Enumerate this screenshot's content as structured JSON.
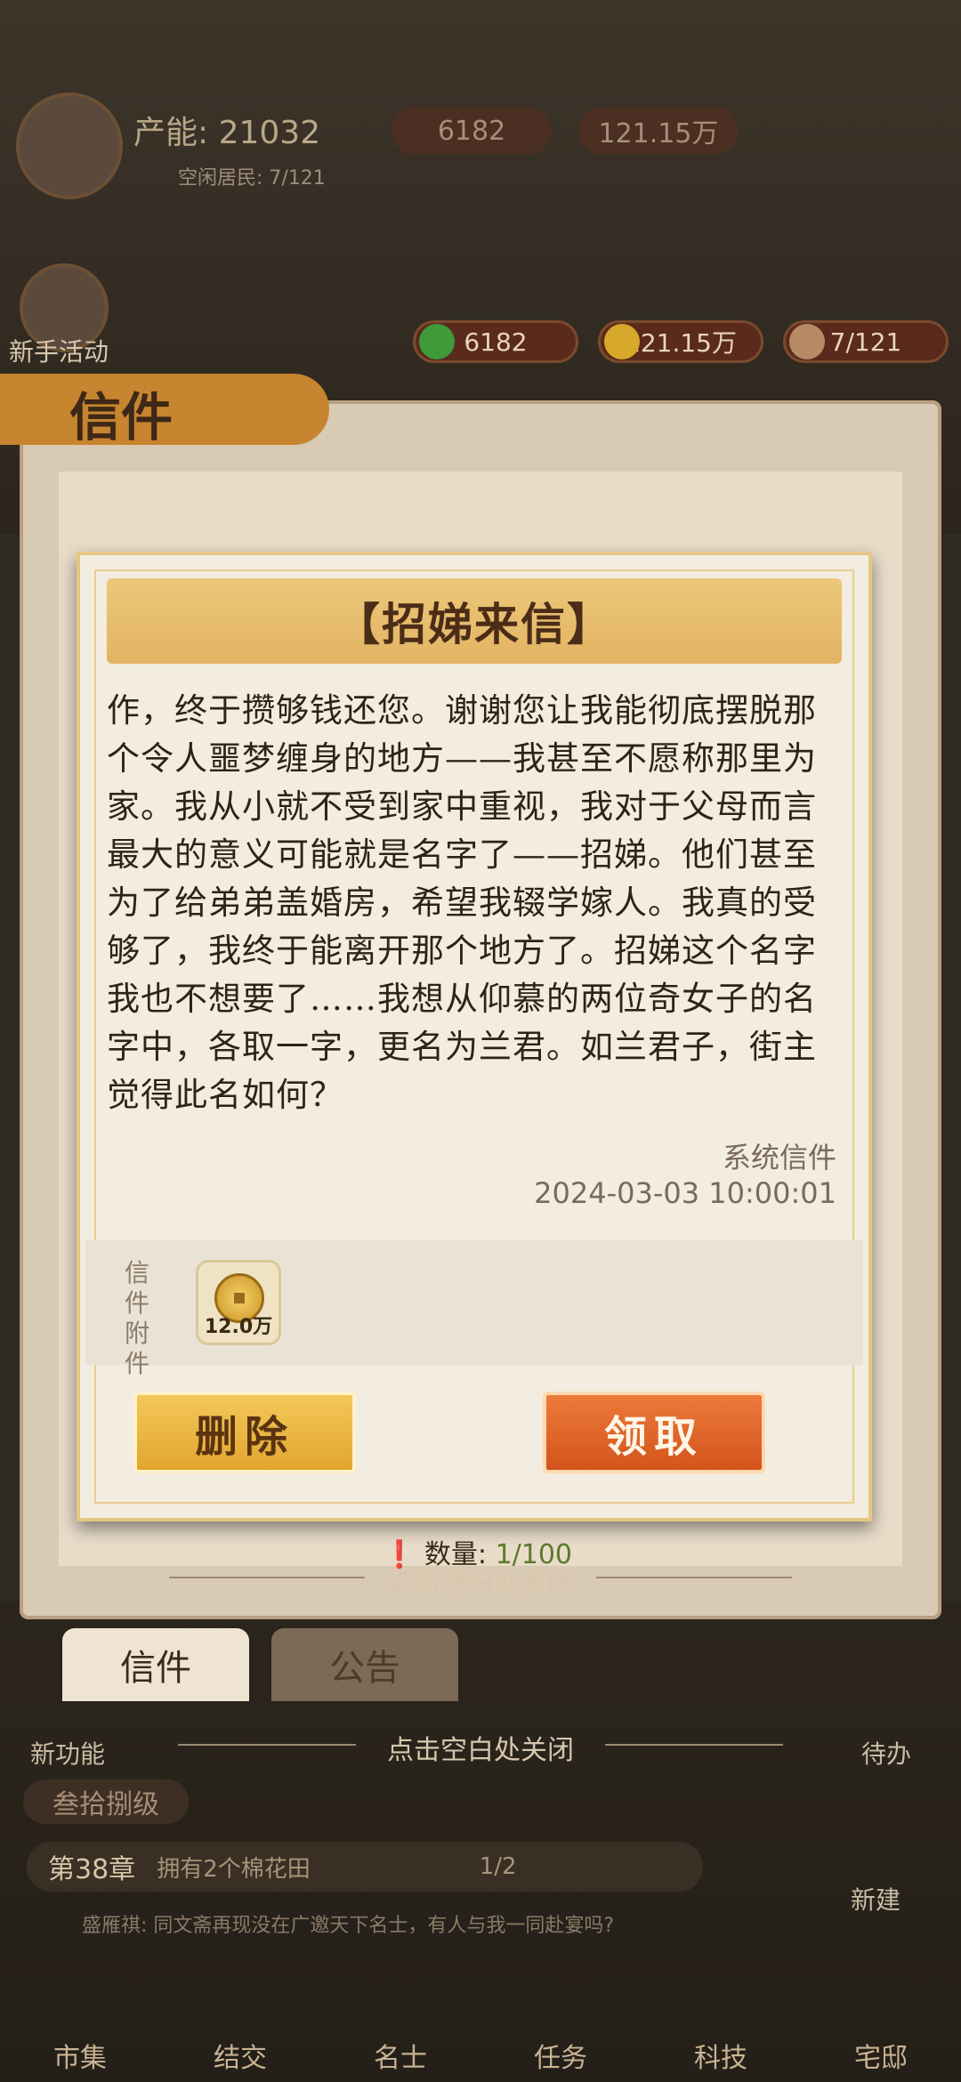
{
  "hud": {
    "power_label": "产能: 21032",
    "idle_residents": "空闲居民: 7/121",
    "coins_top": "6182",
    "money_top": "121.15万",
    "newbie_label": "新手活动",
    "res_coins": "6182",
    "res_money": "121.15万",
    "res_people": "7/121"
  },
  "panel": {
    "title": "信件",
    "qty_label": "数量:",
    "qty_value": "1/100",
    "tabs": [
      {
        "label": "信件"
      },
      {
        "label": "公告"
      }
    ]
  },
  "modal": {
    "title": "【招娣来信】",
    "body": "作，终于攒够钱还您。谢谢您让我能彻底摆脱那个令人噩梦缠身的地方——我甚至不愿称那里为家。我从小就不受到家中重视，我对于父母而言最大的意义可能就是名字了——招娣。他们甚至为了给弟弟盖婚房，希望我辍学嫁人。我真的受够了，我终于能离开那个地方了。招娣这个名字我也不想要了……我想从仰慕的两位奇女子的名字中，各取一字，更名为兰君。如兰君子，街主觉得此名如何？",
    "sender": "系统信件",
    "datetime": "2024-03-03  10:00:01",
    "attachment_label": "信件附件",
    "attachment_qty": "12.0万",
    "delete_label": "删除",
    "claim_label": "领取"
  },
  "hints": {
    "close_1": "点击空白处关闭",
    "close_2": "点击空白处关闭"
  },
  "bottom": {
    "new_feature": "新功能",
    "todo": "待办",
    "build": "新建",
    "upgrade": "叁拾捌级",
    "chapter": "第38章",
    "quest": "拥有2个棉花田",
    "quest_progress": "1/2",
    "chat": "盛雁祺: 同文斋再现没在广邀天下名士，有人与我一同赴宴吗?",
    "nav": [
      "市集",
      "结交",
      "名士",
      "任务",
      "科技",
      "宅邸"
    ]
  }
}
